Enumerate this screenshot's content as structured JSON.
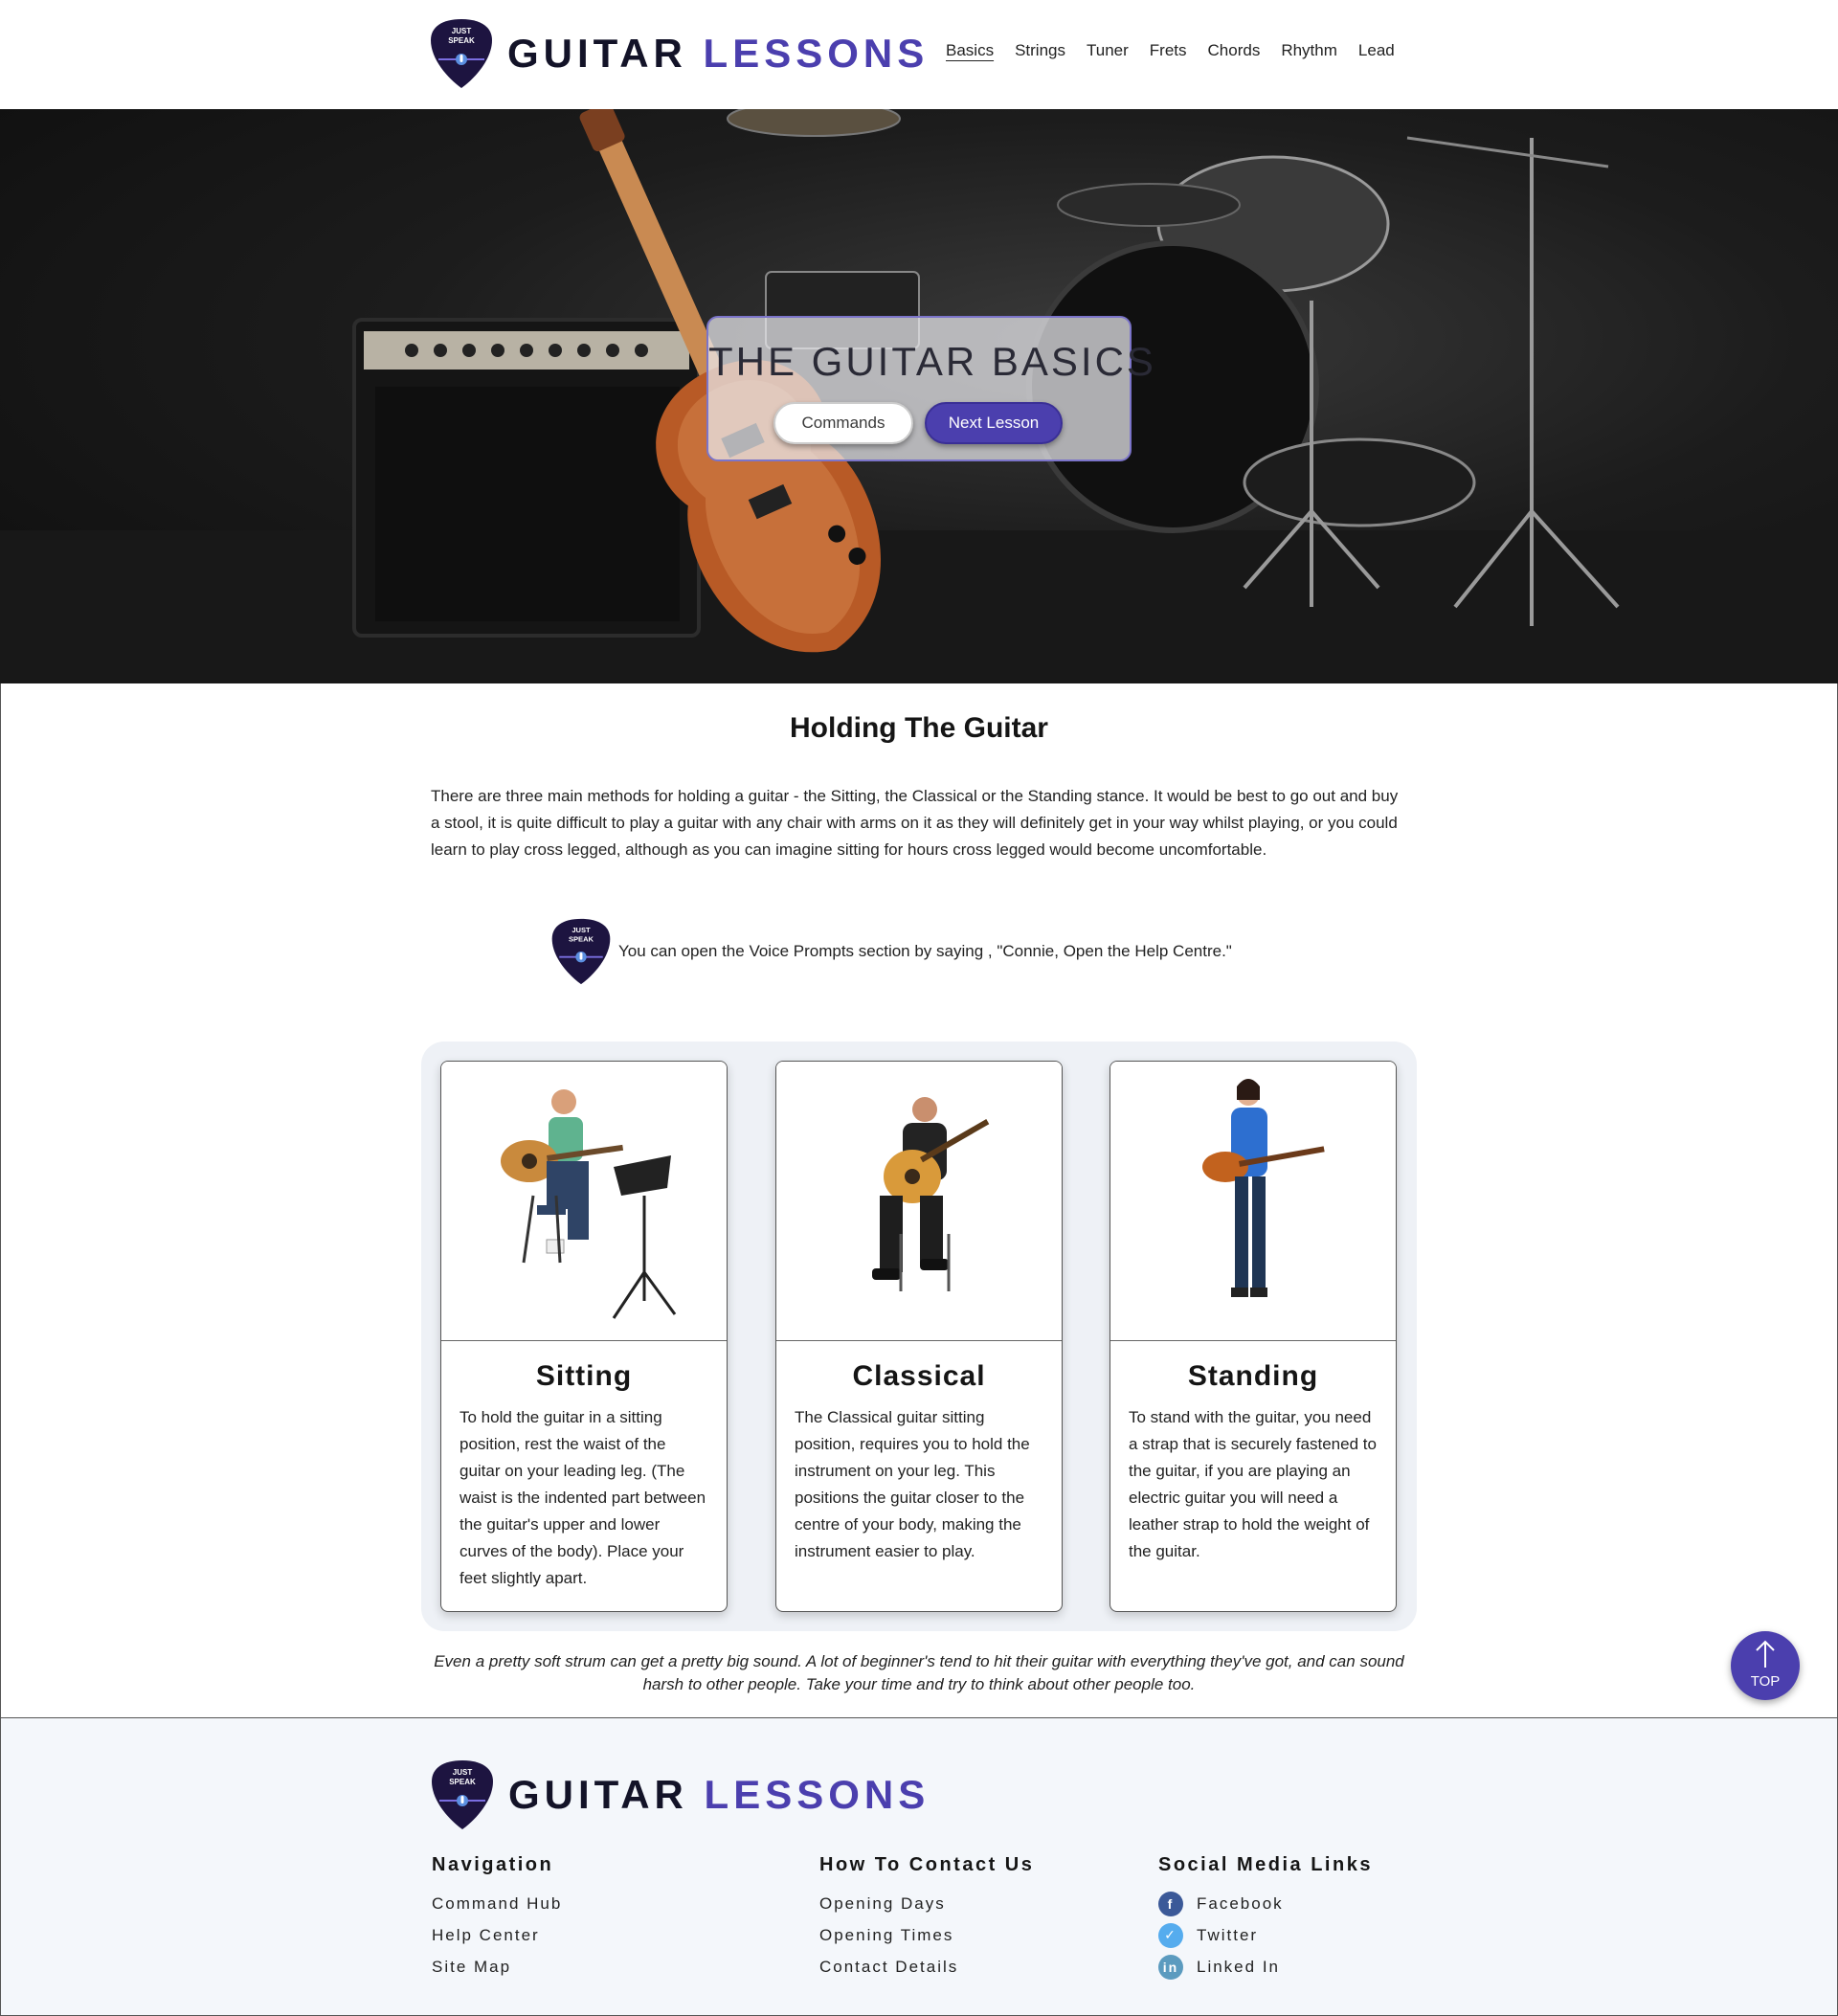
{
  "header": {
    "logo_badge": "JUST SPEAK",
    "brand_main": "GUITAR",
    "brand_accent": "LESSONS",
    "nav": [
      {
        "label": "Basics",
        "active": true
      },
      {
        "label": "Strings"
      },
      {
        "label": "Tuner"
      },
      {
        "label": "Frets"
      },
      {
        "label": "Chords"
      },
      {
        "label": "Rhythm"
      },
      {
        "label": "Lead"
      }
    ]
  },
  "hero": {
    "title": "THE GUITAR BASICS",
    "commands_label": "Commands",
    "next_label": "Next Lesson"
  },
  "main": {
    "heading": "Holding The Guitar",
    "intro": "There are three main methods for holding a guitar - the Sitting, the Classical or the Standing stance. It would be best to go out and buy a stool, it is quite difficult to play a guitar with any chair with arms on it as they will definitely get in your way whilst playing, or you could learn to play cross legged, although as you can imagine sitting for hours cross legged would become uncomfortable.",
    "tip": "You can open the Voice Prompts section by saying , \"Connie, Open the Help Centre.\"",
    "cards": [
      {
        "title": "Sitting",
        "text": "To hold the guitar in a sitting position, rest the waist of the guitar on your leading leg. (The waist is the indented part between the guitar's upper and lower curves of the body). Place your feet slightly apart."
      },
      {
        "title": "Classical",
        "text": "The Classical guitar sitting position, requires you to hold the instrument on your leg. This positions the guitar closer to the centre of your body, making the instrument easier to play."
      },
      {
        "title": "Standing",
        "text": "To stand with the guitar, you need a strap that is securely fastened to the guitar, if you are playing an electric guitar you will need a leather strap to hold the weight of the guitar."
      }
    ],
    "quote": "Even a pretty soft strum can get a pretty big sound. A lot of beginner's tend to hit their guitar with everything they've got, and can sound harsh to other people. Take your time and try to think about other people too.",
    "top_label": "TOP"
  },
  "footer": {
    "brand_main": "GUITAR",
    "brand_accent": "LESSONS",
    "navigation": {
      "heading": "Navigation",
      "links": [
        "Command Hub",
        "Help Center",
        "Site Map"
      ]
    },
    "contact": {
      "heading": "How To Contact Us",
      "links": [
        "Opening Days",
        "Opening Times",
        "Contact Details"
      ]
    },
    "social": {
      "heading": "Social Media Links",
      "links": [
        {
          "label": "Facebook",
          "icon": "facebook-icon",
          "color": "#3b5998"
        },
        {
          "label": "Twitter",
          "icon": "twitter-icon",
          "color": "#55acee"
        },
        {
          "label": "Linked In",
          "icon": "linkedin-icon",
          "color": "#5b9bbf"
        }
      ]
    }
  },
  "colors": {
    "accent": "#4b3fae",
    "dark": "#131328",
    "footer_bg": "#f4f7fb"
  }
}
